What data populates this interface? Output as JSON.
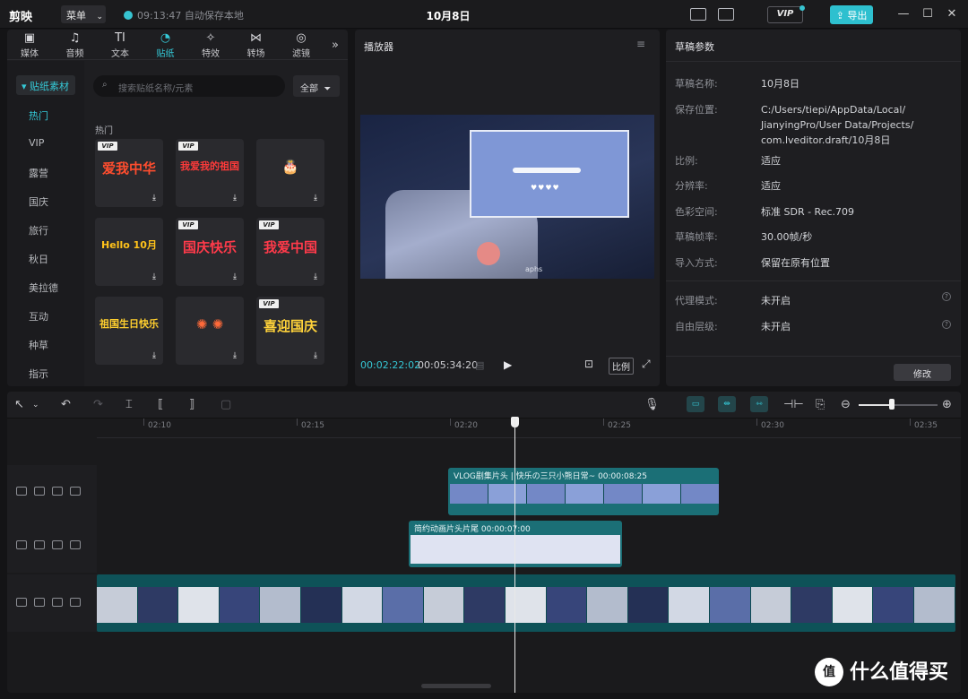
{
  "titlebar": {
    "app_name": "剪映",
    "menu_label": "菜单",
    "save_status": "09:13:47 自动保存本地",
    "doc_title": "10月8日",
    "vip_label": "VIP",
    "export_label": "导出"
  },
  "media_panel": {
    "tabs": [
      {
        "label": "媒体",
        "icon": "media-icon",
        "glyph": "▣"
      },
      {
        "label": "音频",
        "icon": "audio-icon",
        "glyph": "♫"
      },
      {
        "label": "文本",
        "icon": "text-icon",
        "glyph": "TI"
      },
      {
        "label": "贴纸",
        "icon": "sticker-icon",
        "glyph": "◔"
      },
      {
        "label": "特效",
        "icon": "effects-icon",
        "glyph": "✧"
      },
      {
        "label": "转场",
        "icon": "transition-icon",
        "glyph": "⋈"
      },
      {
        "label": "滤镜",
        "icon": "filter-icon",
        "glyph": "◎"
      }
    ],
    "active_tab": "贴纸",
    "more_glyph": "»",
    "side_head": "▾ 贴纸素材",
    "side_items": [
      "热门",
      "VIP",
      "露营",
      "国庆",
      "旅行",
      "秋日",
      "美拉德",
      "互动",
      "种草",
      "指示"
    ],
    "active_side_item": "热门",
    "search_placeholder": "搜索贴纸名称/元素",
    "filter_label": "全部",
    "section_label": "热门",
    "stickers": [
      {
        "text": "爱我中华",
        "color": "#ff4d2e",
        "vip": true
      },
      {
        "text": "我爱我的祖国",
        "color": "#ff3a3a",
        "vip": true
      },
      {
        "text": "🎂",
        "color": "#ffb86b",
        "vip": false
      },
      {
        "text": "Hello 10月",
        "color": "#ffc21a",
        "vip": false
      },
      {
        "text": "国庆快乐",
        "color": "#ff3a4a",
        "vip": true
      },
      {
        "text": "我爱中国",
        "color": "#ff3a4a",
        "vip": true
      },
      {
        "text": "祖国生日快乐",
        "color": "#ffcf2e",
        "vip": false
      },
      {
        "text": "✺ ✺",
        "color": "#ff6a3a",
        "vip": false
      },
      {
        "text": "喜迎国庆",
        "color": "#ffd23a",
        "vip": true
      }
    ],
    "vip_tag": "VIP"
  },
  "player": {
    "title": "播放器",
    "current_time": "00:02:22:02",
    "total_time": "00:05:34:20",
    "ratio_label": "比例",
    "preview_caption": "aphs"
  },
  "draft": {
    "title": "草稿参数",
    "props": [
      {
        "label": "草稿名称:",
        "value": "10月8日"
      },
      {
        "label": "保存位置:",
        "value": "C:/Users/tiepi/AppData/Local/\nJianyingPro/User Data/Projects/\ncom.lveditor.draft/10月8日"
      },
      {
        "label": "比例:",
        "value": "适应"
      },
      {
        "label": "分辨率:",
        "value": "适应"
      },
      {
        "label": "色彩空间:",
        "value": "标准 SDR - Rec.709"
      },
      {
        "label": "草稿帧率:",
        "value": "30.00帧/秒"
      },
      {
        "label": "导入方式:",
        "value": "保留在原有位置"
      },
      {
        "label": "代理模式:",
        "value": "未开启"
      },
      {
        "label": "自由层级:",
        "value": "未开启"
      }
    ],
    "edit_label": "修改"
  },
  "timeline": {
    "ruler_labels": [
      "02:10",
      "02:15",
      "02:20",
      "02:25",
      "02:30",
      "02:35"
    ],
    "clips": [
      {
        "label": "VLOG剧集片头 | 快乐の三只小熊日常~  00:00:08:25"
      },
      {
        "label": "简约动画片头片尾  00:00:07:00"
      }
    ],
    "zoom_fraction": 0.42
  },
  "watermark": {
    "badge": "值",
    "text": "什么值得买"
  }
}
